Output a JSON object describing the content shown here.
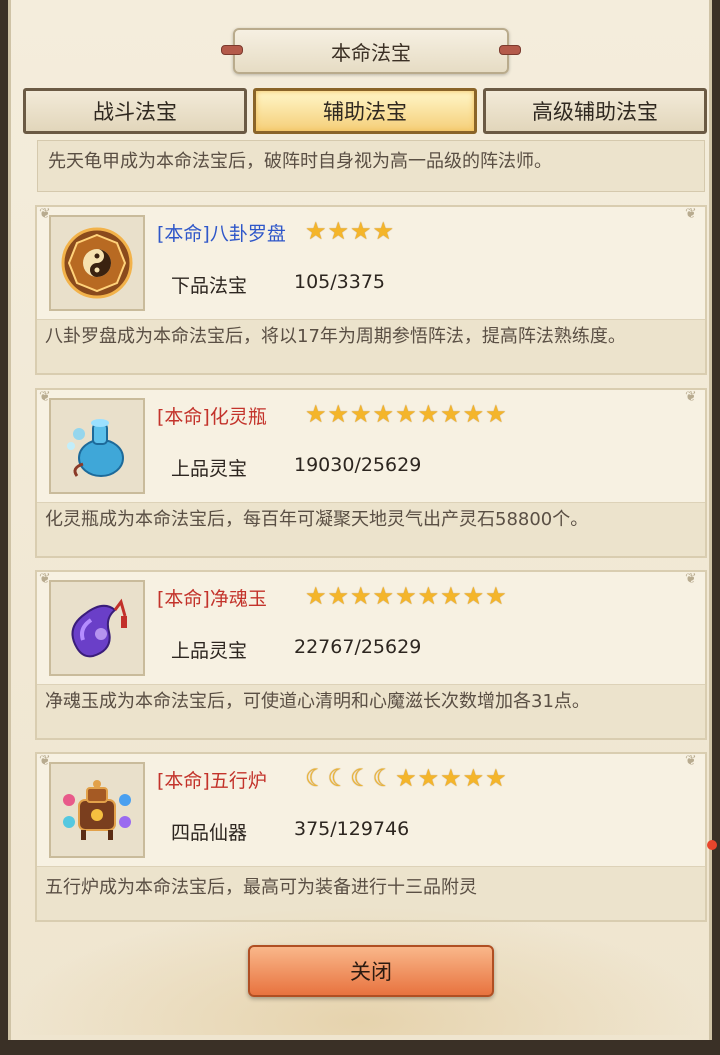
{
  "header": {
    "title": "本命法宝"
  },
  "tabs": [
    {
      "label": "战斗法宝",
      "active": false
    },
    {
      "label": "辅助法宝",
      "active": true
    },
    {
      "label": "高级辅助法宝",
      "active": false
    }
  ],
  "top_description": "先天龟甲成为本命法宝后，破阵时自身视为高一品级的阵法师。",
  "treasures": [
    {
      "name": "[本命]八卦罗盘",
      "name_color": "#2f57c9",
      "icon": "bagua-compass-icon",
      "stars": 4,
      "moons": 0,
      "grade": "下品法宝",
      "progress": "105/3375",
      "description": "八卦罗盘成为本命法宝后，将以17年为周期参悟阵法，提高阵法熟练度。"
    },
    {
      "name": "[本命]化灵瓶",
      "name_color": "#c3332b",
      "icon": "spirit-bottle-icon",
      "stars": 9,
      "moons": 0,
      "grade": "上品灵宝",
      "progress": "19030/25629",
      "description": "化灵瓶成为本命法宝后，每百年可凝聚天地灵气出产灵石58800个。"
    },
    {
      "name": "[本命]净魂玉",
      "name_color": "#c3332b",
      "icon": "soul-jade-icon",
      "stars": 9,
      "moons": 0,
      "grade": "上品灵宝",
      "progress": "22767/25629",
      "description": "净魂玉成为本命法宝后，可使道心清明和心魔滋长次数增加各31点。"
    },
    {
      "name": "[本命]五行炉",
      "name_color": "#c3332b",
      "icon": "five-elements-furnace-icon",
      "stars": 5,
      "moons": 4,
      "grade": "四品仙器",
      "progress": "375/129746",
      "description": "五行炉成为本命法宝后，最高可为装备进行十三品附灵"
    }
  ],
  "close_label": "关闭",
  "colors": {
    "star": "#f4b52a",
    "active_tab": "#f5cf7a",
    "close_button": "#e8733f"
  }
}
